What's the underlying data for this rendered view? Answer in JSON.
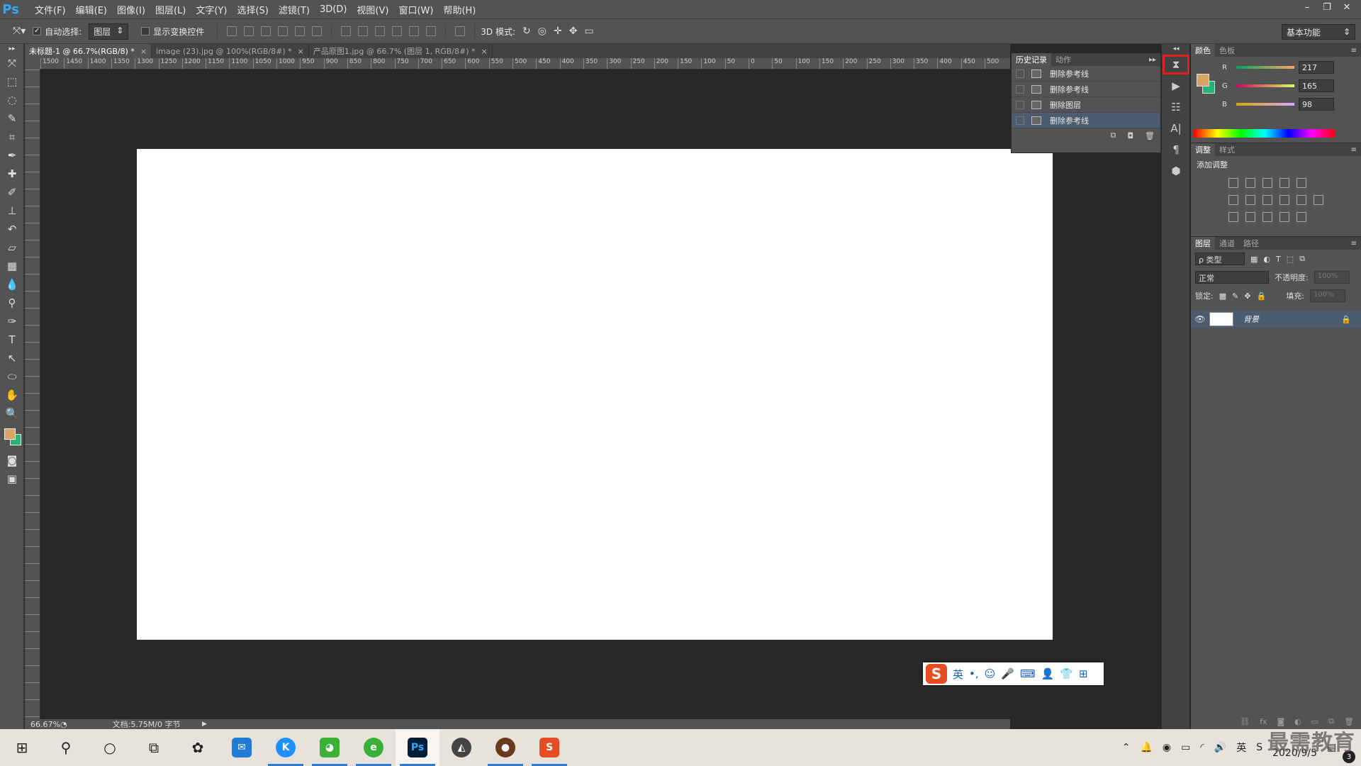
{
  "app": {
    "logo": "Ps"
  },
  "menu": [
    "文件(F)",
    "编辑(E)",
    "图像(I)",
    "图层(L)",
    "文字(Y)",
    "选择(S)",
    "滤镜(T)",
    "3D(D)",
    "视图(V)",
    "窗口(W)",
    "帮助(H)"
  ],
  "window_controls": {
    "minimize": "–",
    "restore": "❐",
    "close": "✕"
  },
  "options": {
    "auto_select_label": "自动选择:",
    "auto_select_value": "图层",
    "show_transform_label": "显示变换控件",
    "mode_3d_label": "3D 模式:",
    "workspace": "基本功能"
  },
  "tabs": [
    {
      "label": "未标题-1 @ 66.7%(RGB/8) *",
      "close": "×"
    },
    {
      "label": "image (23).jpg @ 100%(RGB/8#) *",
      "close": "×"
    },
    {
      "label": "产品原图1.jpg @ 66.7% (图层 1, RGB/8#) *",
      "close": "×"
    }
  ],
  "ruler_h": [
    "1500",
    "1450",
    "1400",
    "1350",
    "1300",
    "1250",
    "1200",
    "1150",
    "1100",
    "1050",
    "1000",
    "950",
    "900",
    "850",
    "800",
    "750",
    "700",
    "650",
    "600",
    "550",
    "500",
    "450",
    "400",
    "350",
    "300",
    "250",
    "200",
    "150",
    "100",
    "50",
    "0",
    "50",
    "100",
    "150",
    "200",
    "250",
    "300",
    "350",
    "400",
    "450",
    "500"
  ],
  "status": {
    "zoom": "66.67%",
    "doc": "文档:5.75M/0 字节"
  },
  "history": {
    "tab1": "历史记录",
    "tab2": "动作",
    "menu": "▸▸",
    "items": [
      "删除参考线",
      "删除参考线",
      "删除图层",
      "删除参考线"
    ]
  },
  "color_panel": {
    "tab1": "颜色",
    "tab2": "色板",
    "r_label": "R",
    "r_value": "217",
    "g_label": "G",
    "g_value": "165",
    "b_label": "B",
    "b_value": "98",
    "fg_color": "#d9a562",
    "bg_color": "#2bb07a"
  },
  "adjustments": {
    "tab1": "调整",
    "tab2": "样式",
    "title": "添加调整"
  },
  "layers": {
    "tab1": "图层",
    "tab2": "通道",
    "tab3": "路径",
    "filter": "ρ 类型",
    "blend": "正常",
    "opacity_label": "不透明度:",
    "opacity_value": "100%",
    "lock_label": "锁定:",
    "fill_label": "填充:",
    "fill_value": "100%",
    "layer_name": "背景"
  },
  "ime": {
    "lang": "英",
    "punct": "•,"
  },
  "taskbar": {
    "clock_date": "2020/9/5",
    "tray_lang": "英",
    "notif_count": "3"
  },
  "watermark": "最需教育"
}
